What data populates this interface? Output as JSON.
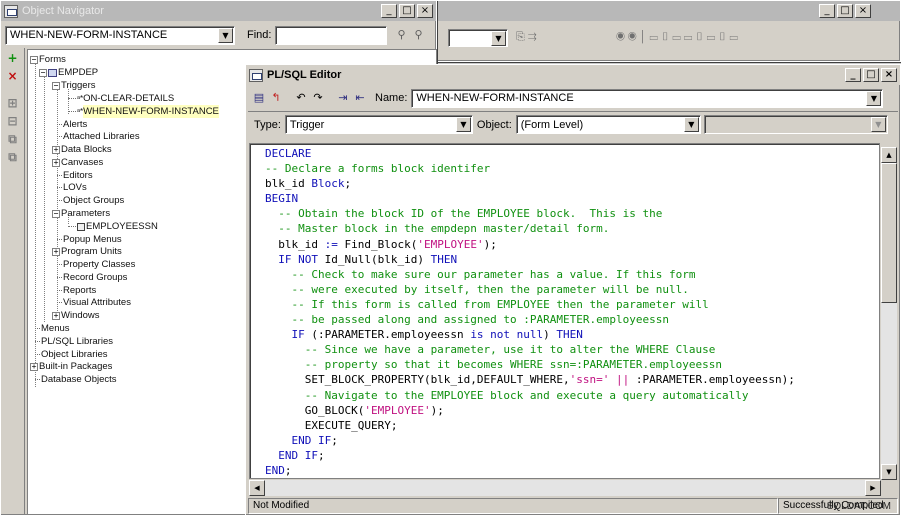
{
  "navigator": {
    "title": "Object Navigator",
    "trigger_select_value": "WHEN-NEW-FORM-INSTANCE",
    "find_label": "Find:",
    "find_value": "",
    "tree": {
      "forms": "Forms",
      "empdep": "EMPDEP",
      "triggers": "Triggers",
      "on_clear_details": "ON-CLEAR-DETAILS",
      "when_new_form_instance": "WHEN-NEW-FORM-INSTANCE",
      "alerts": "Alerts",
      "attached_libraries": "Attached Libraries",
      "data_blocks": "Data Blocks",
      "canvases": "Canvases",
      "editors": "Editors",
      "lovs": "LOVs",
      "object_groups": "Object Groups",
      "parameters": "Parameters",
      "employeessn": "EMPLOYEESSN",
      "popup_menus": "Popup Menus",
      "program_units": "Program Units",
      "property_classes": "Property Classes",
      "record_groups": "Record Groups",
      "reports": "Reports",
      "visual_attributes": "Visual Attributes",
      "windows": "Windows",
      "menus": "Menus",
      "plsql_libraries": "PL/SQL Libraries",
      "object_libraries": "Object Libraries",
      "built_in_packages": "Built-in Packages",
      "database_objects": "Database Objects"
    }
  },
  "editor": {
    "title": "PL/SQL Editor",
    "name_label": "Name:",
    "name_value": "WHEN-NEW-FORM-INSTANCE",
    "type_label": "Type:",
    "type_value": "Trigger",
    "object_label": "Object:",
    "object_value": "(Form Level)",
    "object_value2": "",
    "status_left": "Not Modified",
    "status_right": "Successfully Compiled",
    "code_lines": [
      [
        [
          "kw",
          "DECLARE"
        ]
      ],
      [
        [
          "cm",
          "-- Declare a forms block identifer"
        ]
      ],
      [
        [
          "tx",
          "blk_id "
        ],
        [
          "kw",
          "Block"
        ],
        [
          "tx",
          ";"
        ]
      ],
      [
        [
          "kw",
          "BEGIN"
        ]
      ],
      [
        [
          "cm",
          "  -- Obtain the block ID of the EMPLOYEE block.  This is the"
        ]
      ],
      [
        [
          "cm",
          "  -- Master block in the empdepn master/detail form."
        ]
      ],
      [
        [
          "tx",
          "  blk_id "
        ],
        [
          "kw",
          ":="
        ],
        [
          "tx",
          " Find_Block("
        ],
        [
          "st",
          "'EMPLOYEE'"
        ],
        [
          "tx",
          ");"
        ]
      ],
      [
        [
          "kw",
          "  IF NOT "
        ],
        [
          "tx",
          "Id_Null(blk_id) "
        ],
        [
          "kw",
          "THEN"
        ]
      ],
      [
        [
          "cm",
          "    -- Check to make sure our parameter has a value. If this form"
        ]
      ],
      [
        [
          "cm",
          "    -- were executed by itself, then the parameter will be null."
        ]
      ],
      [
        [
          "cm",
          "    -- If this form is called from EMPLOYEE then the parameter will"
        ]
      ],
      [
        [
          "cm",
          "    -- be passed along and assigned to :PARAMETER.employeessn"
        ]
      ],
      [
        [
          "kw",
          "    IF "
        ],
        [
          "tx",
          "(:PARAMETER.employeessn "
        ],
        [
          "kw",
          "is not null"
        ],
        [
          "tx",
          ") "
        ],
        [
          "kw",
          "THEN"
        ]
      ],
      [
        [
          "cm",
          "      -- Since we have a parameter, use it to alter the WHERE Clause"
        ]
      ],
      [
        [
          "cm",
          "      -- property so that it becomes WHERE ssn=:PARAMETER.employeessn"
        ]
      ],
      [
        [
          "tx",
          "      SET_BLOCK_PROPERTY(blk_id,DEFAULT_WHERE,"
        ],
        [
          "st",
          "'ssn=' || "
        ],
        [
          "tx",
          ":PARAMETER.employeessn);"
        ]
      ],
      [
        [
          "cm",
          "      -- Navigate to the EMPLOYEE block and execute a query automatically"
        ]
      ],
      [
        [
          "tx",
          "      GO_BLOCK("
        ],
        [
          "st",
          "'EMPLOYEE'"
        ],
        [
          "tx",
          ");"
        ]
      ],
      [
        [
          "tx",
          "      EXECUTE_QUERY;"
        ]
      ],
      [
        [
          "kw",
          "    END IF"
        ],
        [
          "tx",
          ";"
        ]
      ],
      [
        [
          "kw",
          "  END IF"
        ],
        [
          "tx",
          ";"
        ]
      ],
      [
        [
          "kw",
          "END"
        ],
        [
          "tx",
          ";"
        ]
      ]
    ]
  },
  "watermark": "SQLDAT.COM"
}
